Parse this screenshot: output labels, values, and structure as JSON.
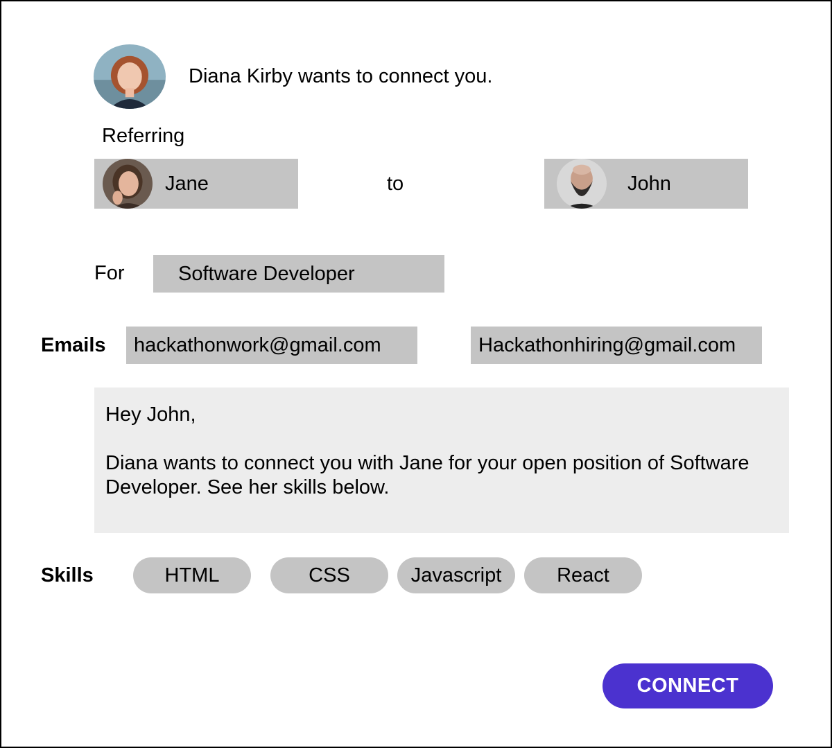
{
  "header": {
    "message": "Diana Kirby wants to connect you."
  },
  "referral": {
    "referring_label": "Referring",
    "from_name": "Jane",
    "connector": "to",
    "to_name": "John"
  },
  "position": {
    "label": "For",
    "value": "Software Developer"
  },
  "emails": {
    "label": "Emails",
    "from_email": "hackathonwork@gmail.com",
    "to_email": "Hackathonhiring@gmail.com"
  },
  "message": {
    "greeting": "Hey John,",
    "body": "Diana wants to connect you with Jane for your open position of Software Developer. See her skills below."
  },
  "skills": {
    "label": "Skills",
    "items": [
      "HTML",
      "CSS",
      "Javascript",
      "React"
    ]
  },
  "actions": {
    "connect_label": "CONNECT"
  },
  "colors": {
    "accent": "#4b32cf",
    "field_background": "#c4c4c4",
    "message_background": "#ededed"
  }
}
